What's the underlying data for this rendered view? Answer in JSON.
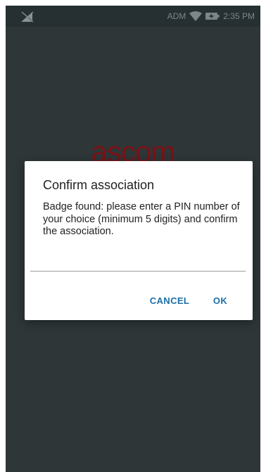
{
  "status_bar": {
    "left_icon": "no-sim-icon",
    "carrier": "ADM",
    "wifi_icon": "wifi-icon",
    "battery_icon": "battery-charging-icon",
    "time": "2:35 PM"
  },
  "background": {
    "logo_text": "ascom",
    "logo_color": "#7a1215",
    "screen_color": "#2e3638"
  },
  "dialog": {
    "title": "Confirm association",
    "message": "Badge found: please enter a PIN number of your choice (minimum 5 digits) and confirm the association.",
    "pin_value": "",
    "cancel_label": "CANCEL",
    "ok_label": "OK",
    "accent_color": "#1b6ea8"
  }
}
